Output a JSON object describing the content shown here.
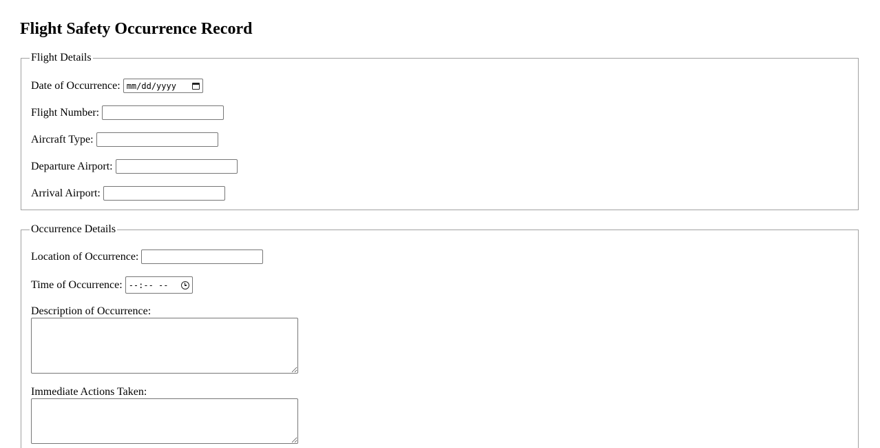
{
  "page": {
    "title": "Flight Safety Occurrence Record"
  },
  "flight_details": {
    "legend": "Flight Details",
    "date_label": "Date of Occurrence:",
    "date_placeholder": "mm/dd/yyyy",
    "flight_number_label": "Flight Number:",
    "flight_number_value": "",
    "aircraft_type_label": "Aircraft Type:",
    "aircraft_type_value": "",
    "departure_airport_label": "Departure Airport:",
    "departure_airport_value": "",
    "arrival_airport_label": "Arrival Airport:",
    "arrival_airport_value": ""
  },
  "occurrence_details": {
    "legend": "Occurrence Details",
    "location_label": "Location of Occurrence:",
    "location_value": "",
    "time_label": "Time of Occurrence:",
    "time_placeholder": "--:-- --",
    "description_label": "Description of Occurrence:",
    "description_value": "",
    "actions_label": "Immediate Actions Taken:",
    "actions_value": ""
  },
  "icons": {
    "date": "calendar-icon",
    "time": "clock-icon"
  }
}
